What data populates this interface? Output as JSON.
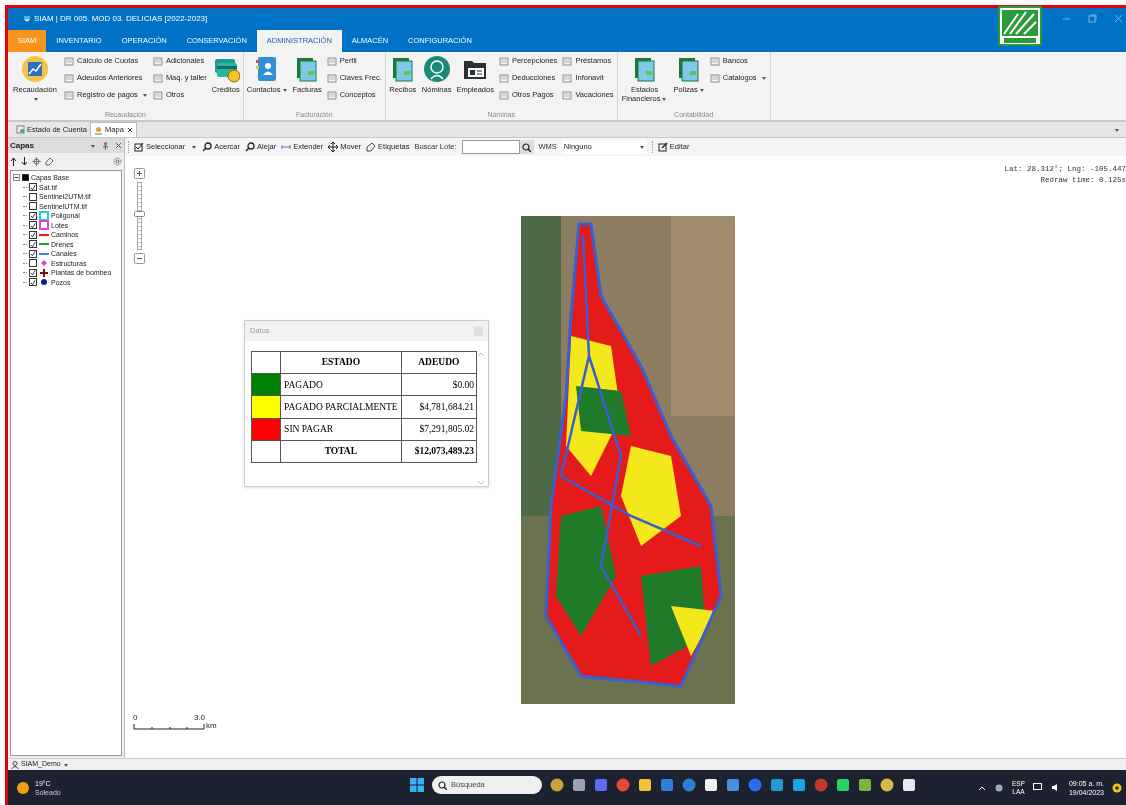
{
  "window": {
    "title": "SIAM | DR 005. MOD 03. DELICIAS [2022-2023]"
  },
  "ribbon_tabs": [
    {
      "label": "SIAM",
      "kind": "app",
      "selected": false
    },
    {
      "label": "INVENTARIO",
      "kind": "tab",
      "selected": false
    },
    {
      "label": "OPERACIÓN",
      "kind": "tab",
      "selected": false
    },
    {
      "label": "CONSERVACIÓN",
      "kind": "tab",
      "selected": false
    },
    {
      "label": "ADMINISTRACIÓN",
      "kind": "tab",
      "selected": true
    },
    {
      "label": "ALMACÉN",
      "kind": "tab",
      "selected": false
    },
    {
      "label": "CONFIGURACIÓN",
      "kind": "tab",
      "selected": false
    }
  ],
  "ribbon_groups": [
    {
      "label": "Recaudación",
      "items": [
        {
          "kind": "large",
          "label": "Recaudación",
          "dropdown": true
        },
        {
          "kind": "column",
          "items": [
            {
              "label": "Cálculo de Cuotas",
              "dropdown": false
            },
            {
              "label": "Adeudos Anteriores",
              "dropdown": false
            },
            {
              "label": "Registro de pagos",
              "dropdown": true
            }
          ]
        },
        {
          "kind": "column",
          "items": [
            {
              "label": "Adicionales",
              "dropdown": false
            },
            {
              "label": "Maq. y taller",
              "dropdown": false
            },
            {
              "label": "Otros",
              "dropdown": false
            }
          ]
        },
        {
          "kind": "large",
          "label": "Créditos",
          "dropdown": false
        }
      ]
    },
    {
      "label": "Facturación",
      "items": [
        {
          "kind": "large",
          "label": "Contactos",
          "dropdown": true
        },
        {
          "kind": "large",
          "label": "Facturas",
          "dropdown": false
        },
        {
          "kind": "column",
          "items": [
            {
              "label": "Perfil",
              "dropdown": false
            },
            {
              "label": "Claves Frec.",
              "dropdown": false
            },
            {
              "label": "Conceptos",
              "dropdown": false
            }
          ]
        }
      ]
    },
    {
      "label": "Nóminas",
      "items": [
        {
          "kind": "large",
          "label": "Recibos",
          "dropdown": false
        },
        {
          "kind": "large",
          "label": "Nóminas",
          "dropdown": false
        },
        {
          "kind": "large",
          "label": "Empleados",
          "dropdown": false
        },
        {
          "kind": "column",
          "items": [
            {
              "label": "Percepciones",
              "dropdown": false
            },
            {
              "label": "Deducciones",
              "dropdown": false
            },
            {
              "label": "Otros Pagos",
              "dropdown": false
            }
          ]
        },
        {
          "kind": "column",
          "items": [
            {
              "label": "Préstamos",
              "dropdown": false
            },
            {
              "label": "Infonavit",
              "dropdown": false
            },
            {
              "label": "Vacaciones",
              "dropdown": false
            }
          ]
        }
      ]
    },
    {
      "label": "Contabilidad",
      "items": [
        {
          "kind": "large",
          "label": "Estados Financieros",
          "dropdown": true
        },
        {
          "kind": "large",
          "label": "Polizas",
          "dropdown": true
        },
        {
          "kind": "column",
          "items": [
            {
              "label": "Bancos",
              "dropdown": false
            },
            {
              "label": "Catalogos",
              "dropdown": true
            }
          ]
        }
      ]
    }
  ],
  "doc_tabs": [
    {
      "label": "Estado de Cuenta",
      "selected": false
    },
    {
      "label": "Mapa",
      "selected": true
    }
  ],
  "layers_panel": {
    "title": "Capas",
    "tree": [
      {
        "label": "Capas Base",
        "checked": true,
        "expanded": true,
        "children": [
          {
            "label": "Sat.tif",
            "checked": true
          },
          {
            "label": "Sentinel2UTM.tif",
            "checked": false
          },
          {
            "label": "SentinelUTM.tif",
            "checked": false
          },
          {
            "label": "Poligonal",
            "checked": true,
            "symbol": {
              "kind": "square",
              "color": "#22d3d3"
            }
          },
          {
            "label": "Lotes",
            "checked": true,
            "symbol": {
              "kind": "square",
              "color": "#d946d9"
            }
          },
          {
            "label": "Caminos",
            "checked": true,
            "symbol": {
              "kind": "line",
              "color": "#e11d1d"
            }
          },
          {
            "label": "Drenes",
            "checked": true,
            "symbol": {
              "kind": "line",
              "color": "#2e9a2e"
            }
          },
          {
            "label": "Canales",
            "checked": true,
            "symbol": {
              "kind": "line",
              "color": "#4a78dd"
            }
          },
          {
            "label": "Estructuras",
            "checked": false,
            "symbol": {
              "kind": "diamond",
              "color": "#e040e0"
            }
          },
          {
            "label": "Plantas de bombeo",
            "checked": true,
            "symbol": {
              "kind": "cross",
              "color": "#7a1010"
            }
          },
          {
            "label": "Pozos",
            "checked": true,
            "symbol": {
              "kind": "dot",
              "color": "#0a1aa0"
            }
          }
        ]
      }
    ]
  },
  "map_toolbar": [
    {
      "kind": "tool",
      "label": "Seleccionar",
      "dropdown": true
    },
    {
      "kind": "tool",
      "label": "Acercar",
      "dropdown": false
    },
    {
      "kind": "tool",
      "label": "Alejar",
      "dropdown": false
    },
    {
      "kind": "tool",
      "label": "Extender",
      "dropdown": false
    },
    {
      "kind": "tool",
      "label": "Mover",
      "dropdown": false
    },
    {
      "kind": "tool",
      "label": "Etiquetas",
      "dropdown": false
    },
    {
      "kind": "label",
      "label": "Buscar Lote:"
    },
    {
      "kind": "input"
    },
    {
      "kind": "search"
    },
    {
      "kind": "label",
      "label": "WMS"
    },
    {
      "kind": "select",
      "value": "Ninguno"
    },
    {
      "kind": "tool",
      "label": "Editar",
      "dropdown": false
    }
  ],
  "map": {
    "zoom": {
      "level": 0.55
    },
    "coordinates": "Lat: 28.312°; Lng: -105.447",
    "redraw": "Redraw time: 0.125s",
    "scale": {
      "start": "0",
      "end": "3.0",
      "unit": "km"
    }
  },
  "datos_panel": {
    "title": "Datos",
    "columns": [
      "ESTADO",
      "ADEUDO"
    ],
    "rows": [
      {
        "kind": "status",
        "color": "#008000",
        "estado": "PAGADO",
        "adeudo": "$0.00"
      },
      {
        "kind": "status",
        "color": "#ffff00",
        "estado": "PAGADO PARCIALMENTE",
        "adeudo": "$4,781,684.21"
      },
      {
        "kind": "status",
        "color": "#ff0000",
        "estado": "SIN PAGAR",
        "adeudo": "$7,291,805.02"
      },
      {
        "kind": "total",
        "estado": "TOTAL",
        "adeudo": "$12,073,489.23"
      }
    ]
  },
  "status_bar": {
    "user": "SIAM_Demo"
  },
  "taskbar": {
    "temperature": "19°C",
    "weather": "Soleado",
    "search_placeholder": "Búsqueda",
    "language": "ESP",
    "layout": "LAA",
    "time": "09:05 a. m.",
    "date": "19/04/2023"
  }
}
